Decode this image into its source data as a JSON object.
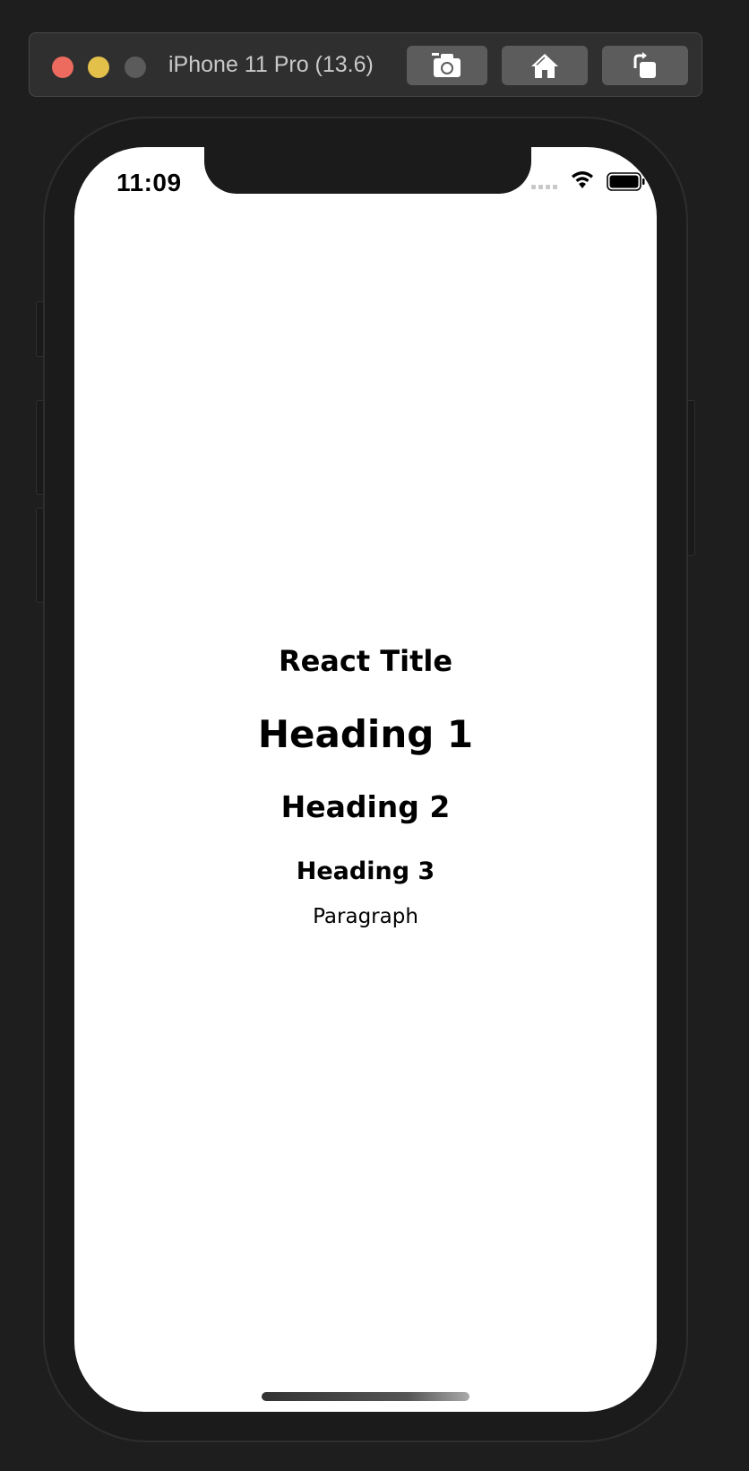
{
  "simulator": {
    "device_title": "iPhone 11 Pro (13.6)",
    "toolbar_buttons": [
      {
        "name": "screenshot",
        "icon": "camera-icon"
      },
      {
        "name": "home",
        "icon": "home-icon"
      },
      {
        "name": "rotate",
        "icon": "rotate-icon"
      }
    ],
    "window_controls": {
      "close_color": "#ec6a5e",
      "minimize_color": "#e3c04a",
      "zoom_color": "#5b5b5b"
    }
  },
  "status_bar": {
    "time": "11:09",
    "icons": [
      "signal-icon",
      "wifi-icon",
      "battery-icon"
    ]
  },
  "app": {
    "react_title": "React Title",
    "heading_1": "Heading 1",
    "heading_2": "Heading 2",
    "heading_3": "Heading 3",
    "paragraph": "Paragraph"
  }
}
